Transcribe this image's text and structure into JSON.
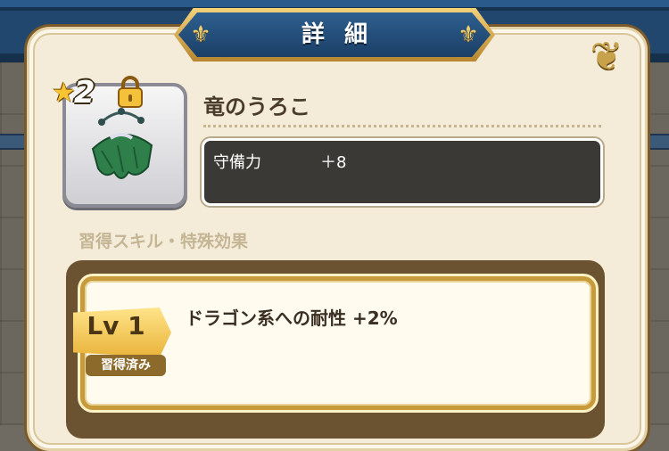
{
  "header": {
    "title": "詳細"
  },
  "item": {
    "rarity": "2",
    "name": "竜のうろこ",
    "icon": "dragon-scale-icon",
    "locked": true
  },
  "stats": [
    {
      "label": "守備力",
      "value": "＋8"
    }
  ],
  "skills": {
    "section_title": "習得スキル・特殊効果",
    "entries": [
      {
        "level": "Lv 1",
        "status": "習得済み",
        "effect": "ドラゴン系への耐性 +2%"
      }
    ]
  },
  "colors": {
    "banner": "#1b3f67",
    "gold": "#e9b33a",
    "panel": "#f4ecd8",
    "stat_box": "#3b3936"
  }
}
